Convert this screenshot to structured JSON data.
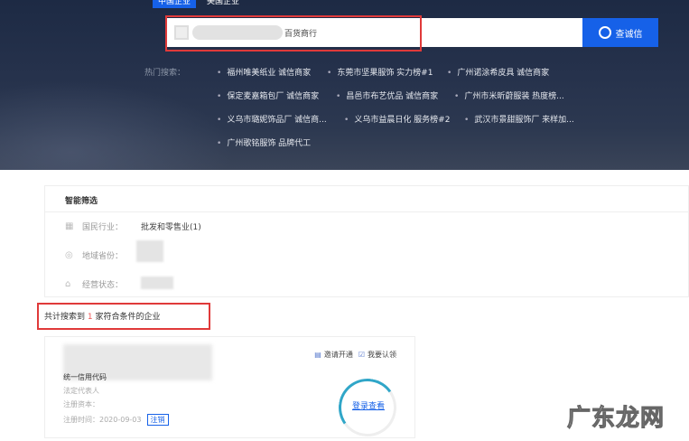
{
  "tabs": [
    "中国企业",
    "美国企业"
  ],
  "search": {
    "value": "百货商行",
    "button": "查诚信"
  },
  "hot": {
    "label": "热门搜索：",
    "items": [
      "福州唯美纸业 诚信商家",
      "东莞市坚果服饰 实力榜#1",
      "广州诺涂希皮具 诚信商家",
      "保定麦嘉箱包厂 诚信商家",
      "昌邑市布艺优品 诚信商家",
      "广州市米昕蔚服装 热度榜...",
      "义乌市璐妮饰品厂 诚信商...",
      "义乌市益晨日化 服务榜#2",
      "武汉市景甜服饰厂 来样加...",
      "广州歌铭服饰 品牌代工"
    ]
  },
  "filter": {
    "title": "智能筛选",
    "rows": [
      {
        "label": "国民行业：",
        "value": "批发和零售业(1)"
      },
      {
        "label": "地域省份：",
        "value": ""
      },
      {
        "label": "经营状态：",
        "value": ""
      }
    ]
  },
  "result": {
    "prefix": "共计搜索到",
    "count": "1",
    "suffix": "家符合条件的企业"
  },
  "card": {
    "credit_code": "统一信用代码",
    "legal_rep": "法定代表人",
    "capital": "注册资本：",
    "reg_time": "注册时间：2020-09-03",
    "status": "注销",
    "invite": "邀请开通",
    "claim": "我要认领",
    "login": "登录查看"
  },
  "watermark": "广东龙网",
  "colors": {
    "accent": "#1661e8",
    "highlight": "#e03a3a"
  }
}
